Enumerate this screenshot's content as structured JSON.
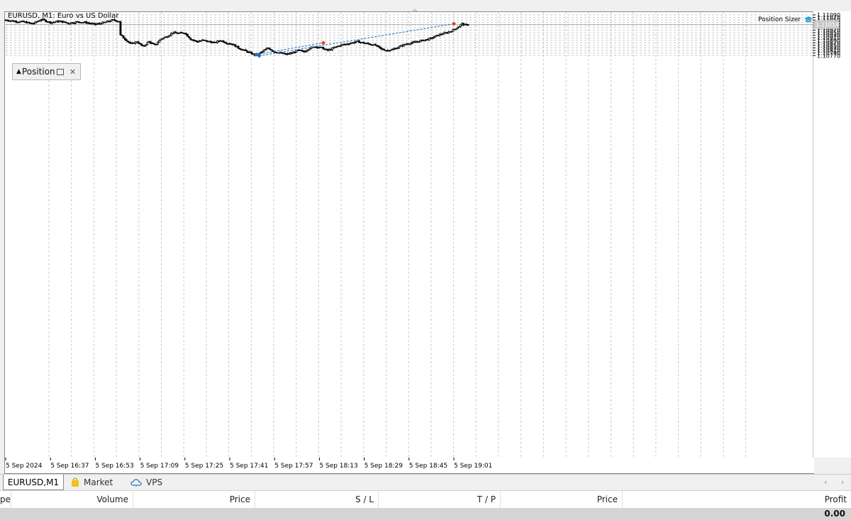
{
  "chart": {
    "title": "EURUSD, M1:  Euro vs US Dollar",
    "indicator_label": "Position Sizer",
    "panel_title": "Position",
    "current_price": "1.11014",
    "price_ticks": [
      "1.11090",
      "1.11070",
      "1.11050",
      "1.11030",
      "1.11010",
      "1.10990",
      "1.10970",
      "1.10950",
      "1.10930",
      "1.10910",
      "1.10890",
      "1.10870",
      "1.10850",
      "1.10830",
      "1.10810",
      "1.10790",
      "1.10770"
    ],
    "time_ticks": [
      "5 Sep 2024",
      "5 Sep 16:37",
      "5 Sep 16:53",
      "5 Sep 17:09",
      "5 Sep 17:25",
      "5 Sep 17:41",
      "5 Sep 17:57",
      "5 Sep 18:13",
      "5 Sep 18:29",
      "5 Sep 18:45",
      "5 Sep 19:01"
    ],
    "colors": {
      "candle": "#000000",
      "grid": "#c8c8c8",
      "trade_line": "#1a6fc4",
      "buy_marker": "#1a6fc4",
      "sell_marker": "#e0401a"
    }
  },
  "chart_data": {
    "type": "candlestick",
    "symbol": "EURUSD",
    "timeframe": "M1",
    "ylim": [
      1.1076,
      1.111
    ],
    "close_path": [
      [
        0,
        1.1105
      ],
      [
        6,
        1.1104
      ],
      [
        12,
        1.11035
      ],
      [
        18,
        1.1102
      ],
      [
        24,
        1.11055
      ],
      [
        30,
        1.1103
      ],
      [
        36,
        1.1104
      ],
      [
        42,
        1.11025
      ],
      [
        48,
        1.11035
      ],
      [
        54,
        1.1103
      ],
      [
        60,
        1.11015
      ],
      [
        66,
        1.1103
      ],
      [
        72,
        1.1105
      ],
      [
        76,
        1.1104
      ],
      [
        77,
        1.1093
      ],
      [
        80,
        1.109
      ],
      [
        84,
        1.1086
      ],
      [
        88,
        1.1088
      ],
      [
        92,
        1.1084
      ],
      [
        96,
        1.1088
      ],
      [
        100,
        1.1085
      ],
      [
        104,
        1.109
      ],
      [
        108,
        1.1092
      ],
      [
        112,
        1.1095
      ],
      [
        116,
        1.10945
      ],
      [
        120,
        1.1095
      ],
      [
        124,
        1.109
      ],
      [
        128,
        1.1088
      ],
      [
        132,
        1.1089
      ],
      [
        136,
        1.1088
      ],
      [
        140,
        1.1087
      ],
      [
        144,
        1.1089
      ],
      [
        148,
        1.1087
      ],
      [
        152,
        1.1086
      ],
      [
        156,
        1.1083
      ],
      [
        160,
        1.1081
      ],
      [
        164,
        1.1079
      ],
      [
        168,
        1.1077
      ],
      [
        172,
        1.108
      ],
      [
        176,
        1.1083
      ],
      [
        180,
        1.108
      ],
      [
        184,
        1.1079
      ],
      [
        188,
        1.1078
      ],
      [
        192,
        1.1079
      ],
      [
        196,
        1.1081
      ],
      [
        200,
        1.108
      ],
      [
        204,
        1.1083
      ],
      [
        208,
        1.1084
      ],
      [
        212,
        1.1083
      ],
      [
        216,
        1.1081
      ],
      [
        220,
        1.1083
      ],
      [
        224,
        1.1085
      ],
      [
        228,
        1.1086
      ],
      [
        232,
        1.1087
      ],
      [
        236,
        1.1088
      ],
      [
        240,
        1.1087
      ],
      [
        244,
        1.1086
      ],
      [
        248,
        1.1085
      ],
      [
        252,
        1.1082
      ],
      [
        256,
        1.1081
      ],
      [
        260,
        1.1082
      ],
      [
        264,
        1.1084
      ],
      [
        268,
        1.1086
      ],
      [
        272,
        1.1087
      ],
      [
        276,
        1.1088
      ],
      [
        280,
        1.1089
      ],
      [
        284,
        1.109
      ],
      [
        288,
        1.1092
      ],
      [
        292,
        1.1094
      ],
      [
        296,
        1.1095
      ],
      [
        300,
        1.1097
      ],
      [
        304,
        1.11
      ],
      [
        306,
        1.1102
      ],
      [
        308,
        1.1101
      ],
      [
        310,
        1.11012
      ]
    ],
    "trades": [
      {
        "type": "buy",
        "entry_time_index": 168,
        "entry_price": 1.10778,
        "exit_price": 1.1087
      },
      {
        "type": "buy",
        "entry_time_index": 170,
        "entry_price": 1.10768,
        "exit_price": 1.1102
      }
    ]
  },
  "tabs": [
    {
      "label": "EURUSD,M1",
      "icon": "none"
    },
    {
      "label": "Market",
      "icon": "bag-icon"
    },
    {
      "label": "VPS",
      "icon": "cloud-icon"
    }
  ],
  "table": {
    "columns": [
      "pe",
      "Volume",
      "Price",
      "S / L",
      "T / P",
      "Price",
      "Profit"
    ],
    "total_profit": "0.00"
  }
}
